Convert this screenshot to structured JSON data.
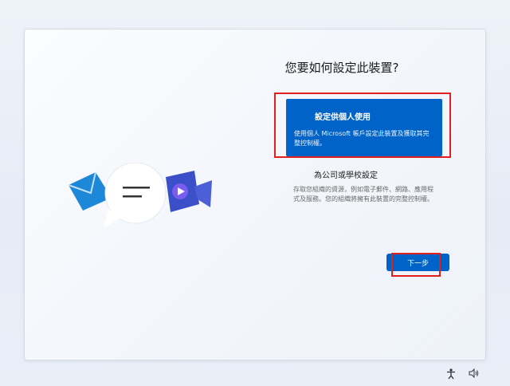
{
  "setup": {
    "title": "您要如何設定此裝置?",
    "personal": {
      "title": "設定供個人使用",
      "description": "使用個人 Microsoft 帳戶設定此裝置及獲取其完整控制權。"
    },
    "work": {
      "title": "為公司或學校設定",
      "description": "存取您組織的資源，例如電子郵件、網路、應用程式及服務。您的組織將擁有此裝置的完整控制權。"
    },
    "next_label": "下一步"
  },
  "icons": {
    "illustration": [
      "mail-icon",
      "chat-bubble-icon",
      "video-call-icon"
    ],
    "tray": [
      "accessibility-icon",
      "volume-icon"
    ]
  },
  "colors": {
    "accent": "#0063c8",
    "highlight": "#e02020"
  }
}
